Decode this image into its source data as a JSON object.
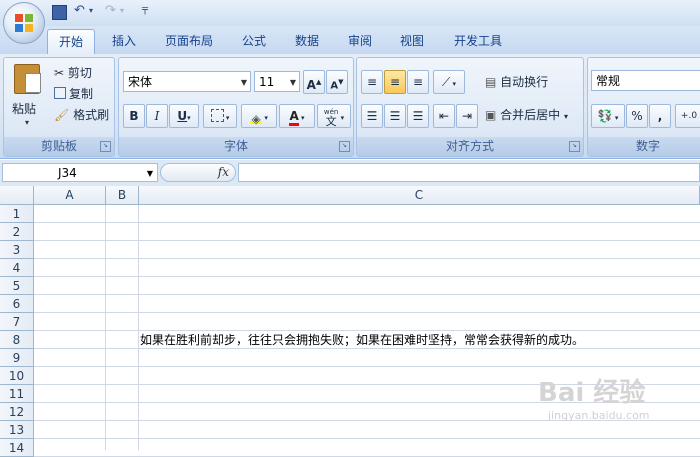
{
  "quick_access": {
    "save_icon": "save-icon",
    "undo_icon": "undo-icon",
    "redo_icon": "redo-icon",
    "customize_icon": "customize-arrow-icon"
  },
  "tabs": [
    "开始",
    "插入",
    "页面布局",
    "公式",
    "数据",
    "审阅",
    "视图",
    "开发工具"
  ],
  "active_tab": "开始",
  "clipboard": {
    "paste_label": "粘贴",
    "cut_label": "剪切",
    "copy_label": "复制",
    "format_painter_label": "格式刷",
    "group_label": "剪贴板"
  },
  "font": {
    "name": "宋体",
    "size": "11",
    "grow_label": "A",
    "shrink_label": "A",
    "bold": "B",
    "italic": "I",
    "underline": "U",
    "wen_label": "wén",
    "wen_char": "文",
    "group_label": "字体"
  },
  "alignment": {
    "wrap_label": "自动换行",
    "merge_label": "合并后居中",
    "group_label": "对齐方式"
  },
  "number": {
    "format": "常规",
    "percent": "%",
    "comma": ",",
    "group_label": "数字",
    "decimal_label": "+.0"
  },
  "formula_bar": {
    "name_box": "J34",
    "fx_label": "fx",
    "formula": ""
  },
  "columns": [
    "A",
    "B",
    "C"
  ],
  "rows": [
    "1",
    "2",
    "3",
    "4",
    "5",
    "6",
    "7",
    "8",
    "9",
    "10",
    "11",
    "12",
    "13",
    "14"
  ],
  "cells": {
    "C8": "如果在胜利前却步，往往只会拥抱失败；如果在困难时坚持，常常会获得新的成功。"
  },
  "watermark": {
    "main": "Bai 经验",
    "sub": "jingyan.baidu.com"
  },
  "colors": {
    "ribbon": "#dbe7f5",
    "tab_text": "#15428b",
    "font_color_red": "#ff0000",
    "fill_yellow": "#ffff00"
  }
}
